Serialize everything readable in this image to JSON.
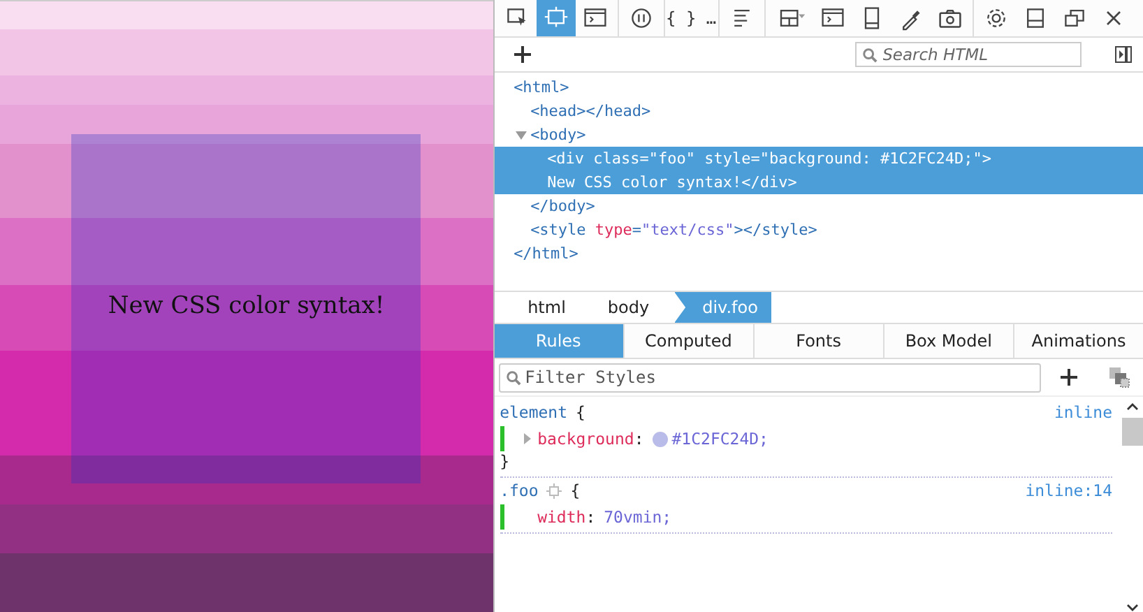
{
  "preview": {
    "text": "New CSS color syntax!"
  },
  "toolbar": {
    "groups": [
      [
        {
          "kind": "picker",
          "selected": false
        },
        {
          "kind": "box",
          "selected": true
        },
        {
          "kind": "console",
          "selected": false
        }
      ],
      [
        {
          "kind": "pause",
          "selected": false
        }
      ],
      [
        {
          "kind": "braces",
          "label": "{ } …",
          "selected": false
        }
      ],
      [
        {
          "kind": "lines",
          "selected": false
        }
      ],
      [
        {
          "kind": "layout",
          "selected": false
        },
        {
          "kind": "console",
          "selected": false
        },
        {
          "kind": "phone",
          "selected": false
        },
        {
          "kind": "dropper",
          "selected": false
        },
        {
          "kind": "camera",
          "selected": false
        }
      ],
      [
        {
          "kind": "gear",
          "selected": false
        },
        {
          "kind": "dock",
          "selected": false
        },
        {
          "kind": "window",
          "selected": false
        },
        {
          "kind": "close",
          "selected": false
        }
      ]
    ]
  },
  "search": {
    "placeholder": "Search HTML"
  },
  "markup": [
    {
      "open": [
        {
          "kind": "tag",
          "text": "<html>"
        }
      ],
      "selected": false,
      "close": [
        {
          "kind": "tag",
          "text": "</html>"
        }
      ],
      "children": [
        {
          "open": [
            {
              "kind": "tag",
              "text": "<head></head>"
            }
          ],
          "selected": false
        },
        {
          "open": [
            {
              "kind": "tag",
              "text": "<body>"
            }
          ],
          "expanded": true,
          "selected": false,
          "close": [
            {
              "kind": "tag",
              "text": "</body>"
            }
          ],
          "children": [
            {
              "lines": [
                "<div class=\"foo\" style=\"background: #1C2FC24D;\">",
                "New CSS color syntax!</div>"
              ],
              "selected": true
            }
          ]
        },
        {
          "open": [
            {
              "kind": "tag",
              "text": "<style "
            },
            {
              "kind": "attr",
              "text": "type"
            },
            {
              "kind": "tag",
              "text": "="
            },
            {
              "kind": "value",
              "text": "\"text/css\""
            },
            {
              "kind": "tag",
              "text": "></style>"
            }
          ],
          "selected": false
        }
      ]
    }
  ],
  "breadcrumbs": [
    {
      "label": "html",
      "selected": false
    },
    {
      "label": "body",
      "selected": false
    },
    {
      "label": "div.foo",
      "selected": true
    }
  ],
  "tabs": [
    {
      "label": "Rules",
      "selected": true
    },
    {
      "label": "Computed",
      "selected": false
    },
    {
      "label": "Fonts",
      "selected": false
    },
    {
      "label": "Box Model",
      "selected": false
    },
    {
      "label": "Animations",
      "selected": false
    }
  ],
  "filter": {
    "placeholder": "Filter Styles"
  },
  "rules": [
    {
      "selector": "element",
      "open": "{",
      "source": "inline",
      "declarations": [
        {
          "property": "background",
          "colon": ":",
          "value": "#1C2FC24D;",
          "color": "#b9bbe9",
          "expandable": true
        }
      ],
      "close": "}"
    },
    {
      "selector": ".foo",
      "highlighter": true,
      "open": "{",
      "source": "inline:14",
      "declarations": [
        {
          "property": "width",
          "colon": ":",
          "value": "70vmin;"
        }
      ]
    }
  ]
}
